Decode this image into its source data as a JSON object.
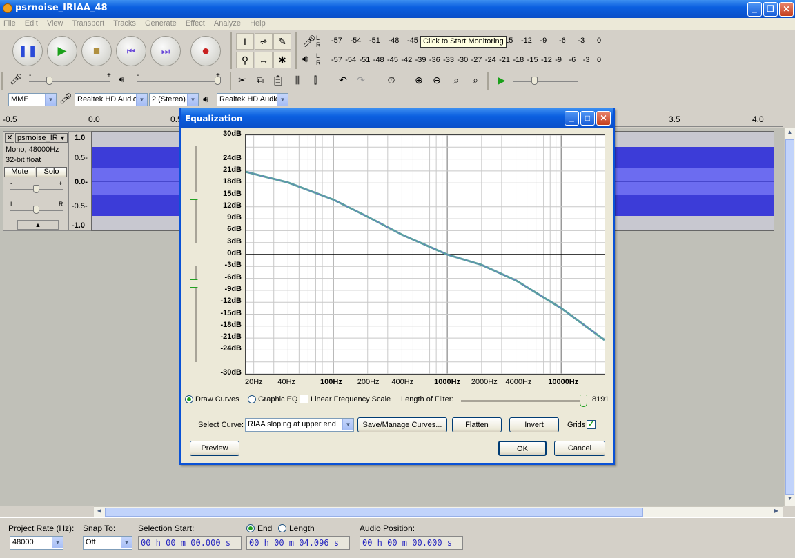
{
  "window": {
    "title": "psrnoise_IRIAA_48",
    "min_label": "_",
    "max_label": "❐",
    "close_label": "✕"
  },
  "menu": [
    "File",
    "Edit",
    "View",
    "Transport",
    "Tracks",
    "Generate",
    "Effect",
    "Analyze",
    "Help"
  ],
  "meters": {
    "record_ticks": [
      "-57",
      "-54",
      "-51",
      "-48",
      "-45",
      "-42",
      "-3",
      "21",
      "-18",
      "-15",
      "-12",
      "-9",
      "-6",
      "-3",
      "0"
    ],
    "record_tooltip": "Click to Start Monitoring",
    "play_ticks": [
      "-57",
      "-54",
      "-51",
      "-48",
      "-45",
      "-42",
      "-39",
      "-36",
      "-33",
      "-30",
      "-27",
      "-24",
      "-21",
      "-18",
      "-15",
      "-12",
      "-9",
      "-6",
      "-3",
      "0"
    ],
    "L": "L",
    "R": "R"
  },
  "device": {
    "host": "MME",
    "rec_device": "Realtek HD Audio",
    "channels": "2 (Stereo)",
    "play_device": "Realtek HD Audio"
  },
  "ruler": [
    {
      "v": "-0.5"
    },
    {
      "v": "0.0"
    },
    {
      "v": "0.5"
    },
    {
      "v": "3.5"
    },
    {
      "v": "4.0"
    }
  ],
  "track": {
    "name": "psrnoise_IR",
    "info1": "Mono, 48000Hz",
    "info2": "32-bit float",
    "mute": "Mute",
    "solo": "Solo",
    "pan_l": "L",
    "pan_r": "R",
    "gain_minus": "-",
    "gain_plus": "+",
    "scale": [
      "1.0",
      "0.5-",
      "0.0-",
      "-0.5-",
      "-1.0"
    ]
  },
  "status": {
    "rate_label": "Project Rate (Hz):",
    "rate_value": "48000",
    "snap_label": "Snap To:",
    "snap_value": "Off",
    "sel_start_label": "Selection Start:",
    "sel_start_value": "00 h 00 m 00.000 s",
    "end_label": "End",
    "length_label": "Length",
    "end_value": "00 h 00 m 04.096 s",
    "audio_pos_label": "Audio Position:",
    "audio_pos_value": "00 h 00 m 00.000 s"
  },
  "dialog": {
    "title": "Equalization",
    "db_labels": [
      "30dB",
      "24dB",
      "21dB",
      "18dB",
      "15dB",
      "12dB",
      "9dB",
      "6dB",
      "3dB",
      "0dB",
      "-3dB",
      "-6dB",
      "-9dB",
      "-12dB",
      "-15dB",
      "-18dB",
      "-21dB",
      "-24dB",
      "-30dB"
    ],
    "hz_labels": [
      "20Hz",
      "40Hz",
      "100Hz",
      "200Hz",
      "400Hz",
      "1000Hz",
      "2000Hz",
      "4000Hz",
      "10000Hz"
    ],
    "draw_curves": "Draw Curves",
    "graphic_eq": "Graphic EQ",
    "linear_scale": "Linear Frequency Scale",
    "filter_length_label": "Length of Filter:",
    "filter_length_value": "8191",
    "select_curve_label": "Select Curve:",
    "select_curve_value": "RIAA sloping at upper end",
    "save_manage": "Save/Manage Curves...",
    "flatten": "Flatten",
    "invert": "Invert",
    "grids": "Grids",
    "preview": "Preview",
    "ok": "OK",
    "cancel": "Cancel"
  },
  "chart_data": {
    "type": "line",
    "xscale": "log",
    "xlim": [
      17,
      24000
    ],
    "ylim": [
      -30,
      30
    ],
    "xticks": [
      "20Hz",
      "40Hz",
      "100Hz",
      "200Hz",
      "400Hz",
      "1000Hz",
      "2000Hz",
      "4000Hz",
      "10000Hz"
    ],
    "yticks": [
      "30dB",
      "24dB",
      "21dB",
      "18dB",
      "15dB",
      "12dB",
      "9dB",
      "6dB",
      "3dB",
      "0dB",
      "-3dB",
      "-6dB",
      "-9dB",
      "-12dB",
      "-15dB",
      "-18dB",
      "-21dB",
      "-24dB",
      "-30dB"
    ],
    "grid": true,
    "series": [
      {
        "x": [
          17,
          40,
          100,
          200,
          400,
          1000,
          2000,
          4000,
          10000,
          24000
        ],
        "y": [
          20.8,
          18.1,
          13.8,
          9.5,
          5.0,
          0.0,
          -2.6,
          -6.5,
          -13.5,
          -21.5
        ]
      }
    ]
  }
}
